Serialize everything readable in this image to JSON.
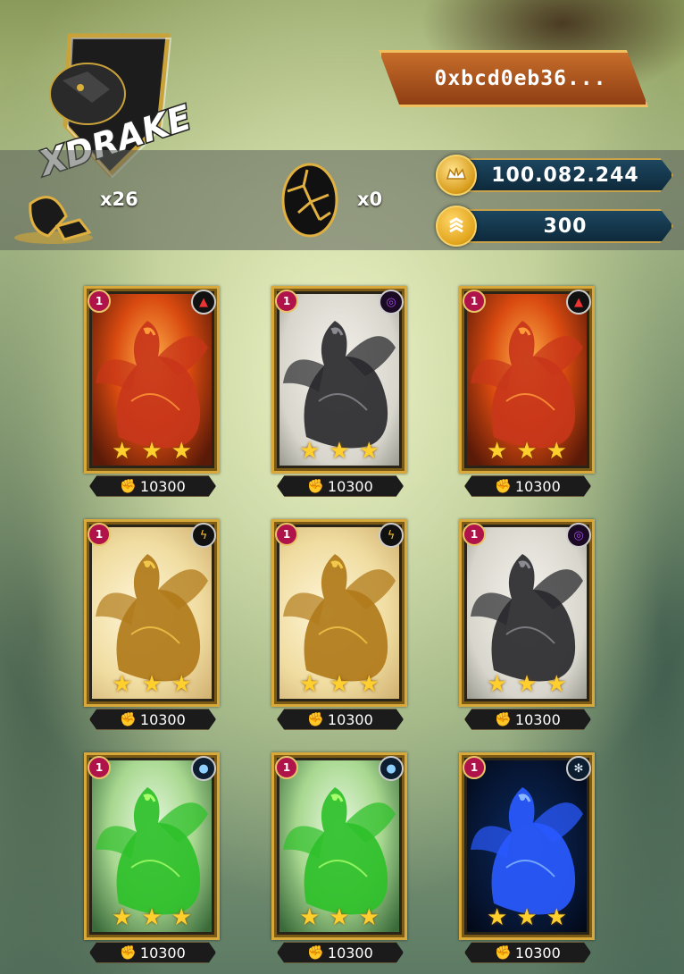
{
  "logo": {
    "text": "XDRAKE"
  },
  "wallet": {
    "address": "0xbcd0eb36..."
  },
  "inventory": {
    "items": [
      {
        "name": "shell",
        "count": "x26"
      },
      {
        "name": "egg",
        "count": "x0"
      }
    ]
  },
  "balances": [
    {
      "name": "gold-coin",
      "value": "100.082.244"
    },
    {
      "name": "token",
      "value": "300"
    }
  ],
  "cards": [
    {
      "level": "1",
      "element": "fire",
      "power": "10300",
      "stars": 3,
      "dragon": "red"
    },
    {
      "level": "1",
      "element": "dark",
      "power": "10300",
      "stars": 3,
      "dragon": "black"
    },
    {
      "level": "1",
      "element": "fire",
      "power": "10300",
      "stars": 3,
      "dragon": "red"
    },
    {
      "level": "1",
      "element": "lightning",
      "power": "10300",
      "stars": 3,
      "dragon": "gold"
    },
    {
      "level": "1",
      "element": "lightning",
      "power": "10300",
      "stars": 3,
      "dragon": "gold"
    },
    {
      "level": "1",
      "element": "dark",
      "power": "10300",
      "stars": 3,
      "dragon": "black"
    },
    {
      "level": "1",
      "element": "water",
      "power": "10300",
      "stars": 3,
      "dragon": "green"
    },
    {
      "level": "1",
      "element": "water",
      "power": "10300",
      "stars": 3,
      "dragon": "green"
    },
    {
      "level": "1",
      "element": "ice",
      "power": "10300",
      "stars": 3,
      "dragon": "blue"
    }
  ]
}
